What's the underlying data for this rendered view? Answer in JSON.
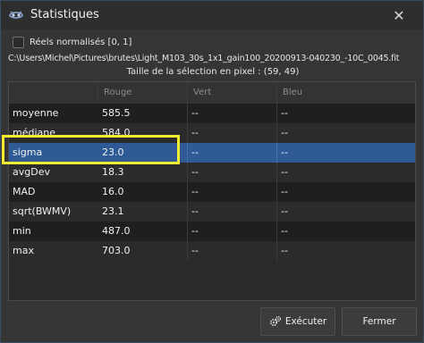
{
  "window": {
    "title": "Statistiques",
    "icon": "siril-icon",
    "close_glyph": "✕"
  },
  "options": {
    "normalized_label": "Réels normalisés [0, 1]",
    "normalized_checked": false
  },
  "file_path": "C:\\Users\\Michel\\Pictures\\brutes\\Light_M103_30s_1x1_gain100_20200913-040230_-10C_0045.fit",
  "selection_size": "Taille de la sélection en pixel : (59, 49)",
  "table": {
    "headers": [
      "",
      "Rouge",
      "Vert",
      "Bleu"
    ],
    "rows": [
      {
        "name": "moyenne",
        "rouge": "585.5",
        "vert": "--",
        "bleu": "--"
      },
      {
        "name": "médiane",
        "rouge": "584.0",
        "vert": "--",
        "bleu": "--"
      },
      {
        "name": "sigma",
        "rouge": "23.0",
        "vert": "--",
        "bleu": "--"
      },
      {
        "name": "avgDev",
        "rouge": "18.3",
        "vert": "--",
        "bleu": "--"
      },
      {
        "name": "MAD",
        "rouge": "16.0",
        "vert": "--",
        "bleu": "--"
      },
      {
        "name": "sqrt(BWMV)",
        "rouge": "23.1",
        "vert": "--",
        "bleu": "--"
      },
      {
        "name": "min",
        "rouge": "487.0",
        "vert": "--",
        "bleu": "--"
      },
      {
        "name": "max",
        "rouge": "703.0",
        "vert": "--",
        "bleu": "--"
      }
    ],
    "selected_row": "sigma"
  },
  "buttons": {
    "execute_label": "Exécuter",
    "execute_icon": "gears-icon",
    "close_label": "Fermer"
  },
  "colors": {
    "selection": "#2f5a96",
    "highlight": "#f5ec2f"
  }
}
